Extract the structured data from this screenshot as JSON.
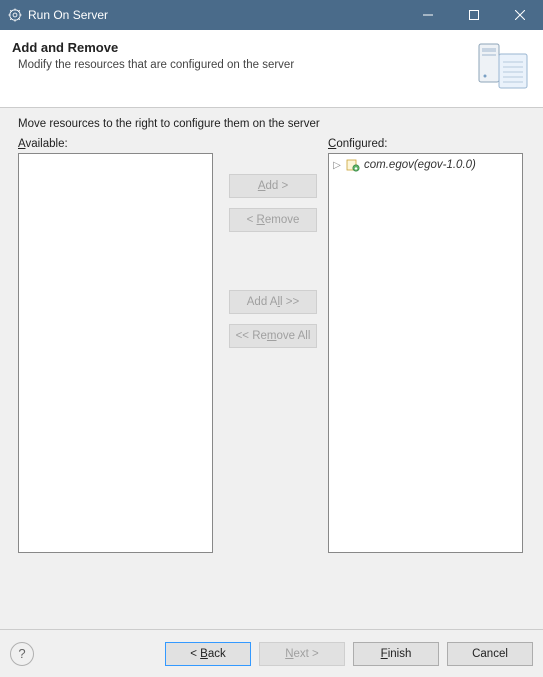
{
  "window": {
    "title": "Run On Server"
  },
  "header": {
    "title": "Add and Remove",
    "subtitle": "Modify the resources that are configured on the server"
  },
  "body": {
    "instruction": "Move resources to the right to configure them on the server",
    "available_label_pre": "A",
    "available_label_rest": "vailable:",
    "configured_label_pre": "C",
    "configured_label_rest": "onfigured:",
    "buttons": {
      "add_pre": "A",
      "add_rest": "dd >",
      "remove_pre": "< ",
      "remove_mn": "R",
      "remove_rest": "emove",
      "addall_pre": "Add A",
      "addall_mn": "l",
      "addall_rest": "l >>",
      "removeall_pre": "<< Re",
      "removeall_mn": "m",
      "removeall_rest": "ove All"
    },
    "available_items": [],
    "configured_items": [
      {
        "label": "com.egov(egov-1.0.0)"
      }
    ]
  },
  "footer": {
    "back_pre": "< ",
    "back_mn": "B",
    "back_rest": "ack",
    "next_mn": "N",
    "next_rest": "ext >",
    "finish_mn": "F",
    "finish_rest": "inish",
    "cancel": "Cancel"
  }
}
